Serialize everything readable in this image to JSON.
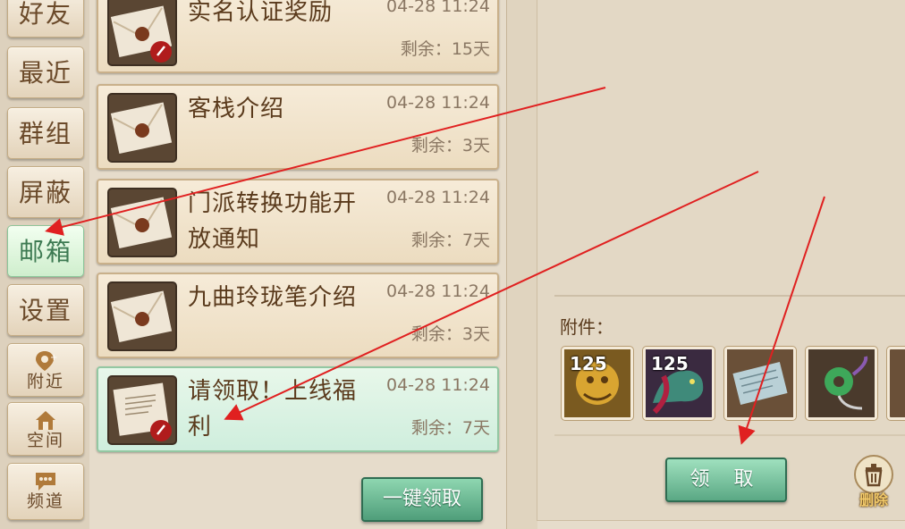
{
  "tabs": [
    {
      "label": "好友"
    },
    {
      "label": "最近"
    },
    {
      "label": "群组"
    },
    {
      "label": "屏蔽"
    },
    {
      "label": "邮箱"
    },
    {
      "label": "设置"
    },
    {
      "label": "附近",
      "icon": "location-plus-icon"
    },
    {
      "label": "空间",
      "icon": "house-icon"
    },
    {
      "label": "频道",
      "icon": "chat-bubble-icon"
    }
  ],
  "mails": [
    {
      "title": "实名认证奖励",
      "time": "04-28 11:24",
      "remain": "剩余：15天"
    },
    {
      "title": "客栈介绍",
      "time": "04-28 11:24",
      "remain": "剩余：3天"
    },
    {
      "title": "门派转换功能开放通知",
      "time": "04-28 11:24",
      "remain": "剩余：7天"
    },
    {
      "title": "九曲玲珑笔介绍",
      "time": "04-28 11:24",
      "remain": "剩余：3天"
    },
    {
      "title": "请领取！上线福利",
      "time": "04-28 11:24",
      "remain": "剩余：7天"
    }
  ],
  "claim_all_label": "一键领取",
  "detail": {
    "attach_label": "附件：",
    "items": [
      {
        "icon": "golden-beast-icon",
        "level": "125"
      },
      {
        "icon": "dragon-icon",
        "level": "125"
      },
      {
        "icon": "scroll-icon",
        "level": ""
      },
      {
        "icon": "jade-pendant-icon",
        "level": ""
      }
    ],
    "claim_label": "领 取",
    "delete_label": "删除"
  },
  "colors": {
    "accent_green": "#5aa884",
    "arrow_red": "#e02020",
    "text_brown": "#5a3a1c"
  }
}
